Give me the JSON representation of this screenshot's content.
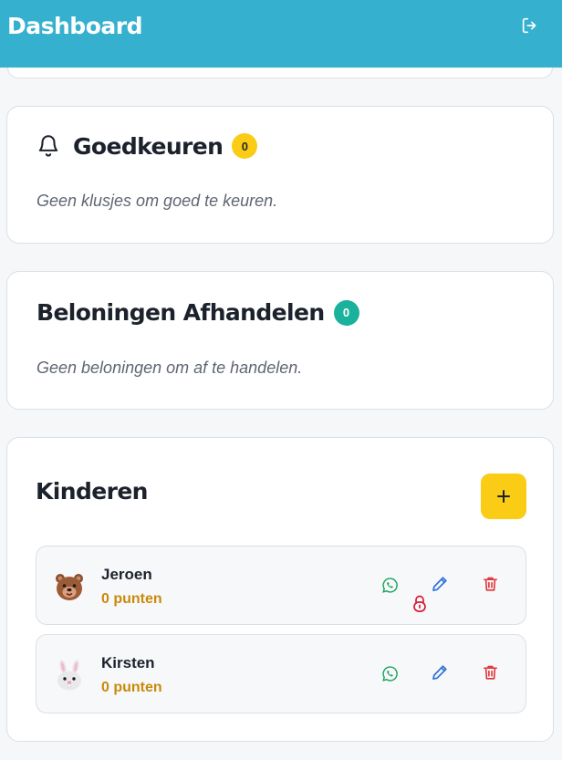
{
  "header": {
    "title": "Dashboard",
    "logout_icon": "logout-icon"
  },
  "approvals": {
    "title": "Goedkeuren",
    "count": "0",
    "empty_text": "Geen klusjes om goed te keuren.",
    "icon": "bell-icon"
  },
  "rewards": {
    "title": "Beloningen Afhandelen",
    "count": "0",
    "empty_text": "Geen beloningen om af te handelen."
  },
  "kids": {
    "title": "Kinderen",
    "add_icon": "plus-icon",
    "items": [
      {
        "name": "Jeroen",
        "points": "0 punten",
        "avatar": "bear-icon",
        "locked": true
      },
      {
        "name": "Kirsten",
        "points": "0 punten",
        "avatar": "bunny-icon",
        "locked": false
      }
    ]
  },
  "colors": {
    "header_bg": "#35b1cf",
    "accent_yellow": "#facc15",
    "badge_teal": "#1ab29c",
    "points": "#c98a0a",
    "check_green": "#1aa35a",
    "edit_blue": "#2f6fd8",
    "delete_red": "#e0333a"
  }
}
